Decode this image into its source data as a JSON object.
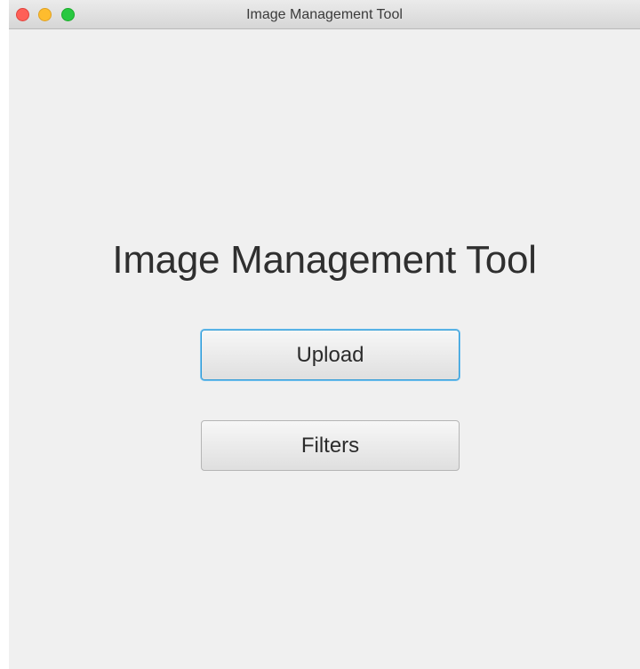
{
  "window": {
    "title": "Image Management Tool",
    "controls": {
      "close_color": "#fe5f57",
      "minimize_color": "#febc2e",
      "zoom_color": "#28c840"
    }
  },
  "main": {
    "heading": "Image Management Tool",
    "buttons": {
      "upload_label": "Upload",
      "filters_label": "Filters"
    },
    "focused_button": "upload"
  },
  "colors": {
    "background": "#f0f0f0",
    "focus_ring": "#2a9ad8"
  }
}
